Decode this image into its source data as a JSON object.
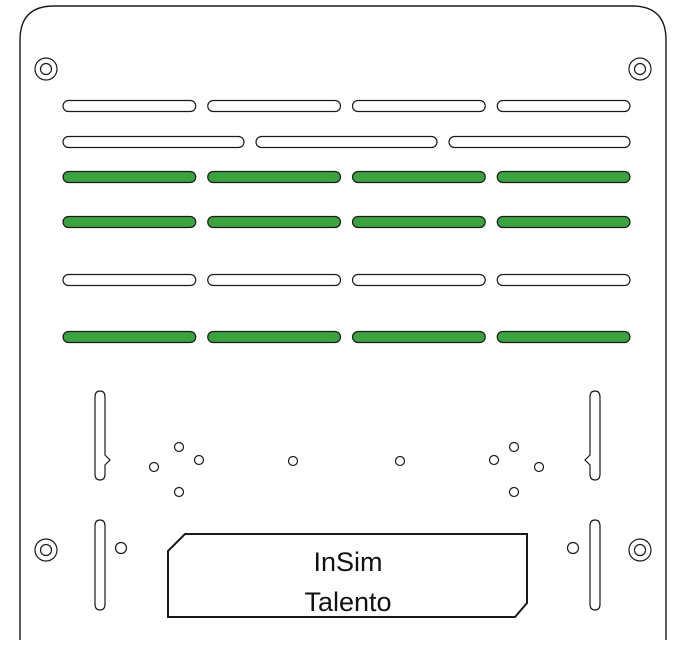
{
  "panel": {
    "label_line1": "InSim",
    "label_line2": "Talento"
  },
  "colors": {
    "outline": "#1a1a1a",
    "slot_active": "#3aa33f",
    "slot_inactive": "#ffffff",
    "background": "#ffffff"
  },
  "slot_rows": [
    {
      "slots": 4,
      "active": false
    },
    {
      "slots": 3,
      "active": false
    },
    {
      "slots": 4,
      "active": true
    },
    {
      "slots": 4,
      "active": true
    },
    {
      "slots": 4,
      "active": false
    },
    {
      "slots": 4,
      "active": true
    }
  ]
}
